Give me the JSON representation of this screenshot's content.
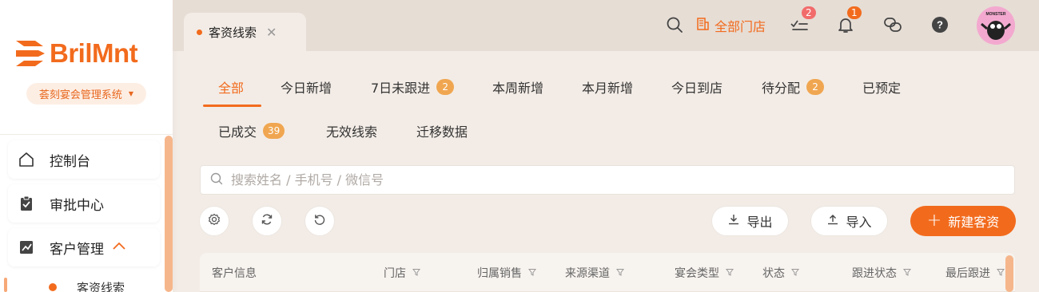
{
  "brand": {
    "logo_text": "BrilMnt",
    "system_name": "荟刻宴会管理系统",
    "accent": "#f26b1d"
  },
  "sidebar": {
    "items": [
      {
        "label": "控制台",
        "icon": "home-icon"
      },
      {
        "label": "审批中心",
        "icon": "clipboard-check-icon"
      },
      {
        "label": "客户管理",
        "icon": "chart-line-icon",
        "expanded": true
      }
    ],
    "sub_items": [
      {
        "label": "客资线索",
        "active": true
      }
    ]
  },
  "header": {
    "open_tab": "客资线索",
    "store_label": "全部门店",
    "todo_badge": "2",
    "notification_badge": "1",
    "avatar_label": "MONSTER"
  },
  "filters": {
    "tabs": [
      {
        "label": "全部",
        "active": true
      },
      {
        "label": "今日新增"
      },
      {
        "label": "7日未跟进",
        "count": "2"
      },
      {
        "label": "本周新增"
      },
      {
        "label": "本月新增"
      },
      {
        "label": "今日到店"
      },
      {
        "label": "待分配",
        "count": "2"
      },
      {
        "label": "已预定"
      },
      {
        "label": "已成交",
        "count": "39"
      },
      {
        "label": "无效线索"
      },
      {
        "label": "迁移数据"
      }
    ]
  },
  "search": {
    "placeholder": "搜索姓名 / 手机号 / 微信号",
    "value": ""
  },
  "toolbar": {
    "export_label": "导出",
    "import_label": "导入",
    "create_label": "新建客资"
  },
  "table": {
    "columns": [
      "客户信息",
      "门店",
      "归属销售",
      "来源渠道",
      "宴会类型",
      "状态",
      "跟进状态",
      "最后跟进"
    ]
  }
}
